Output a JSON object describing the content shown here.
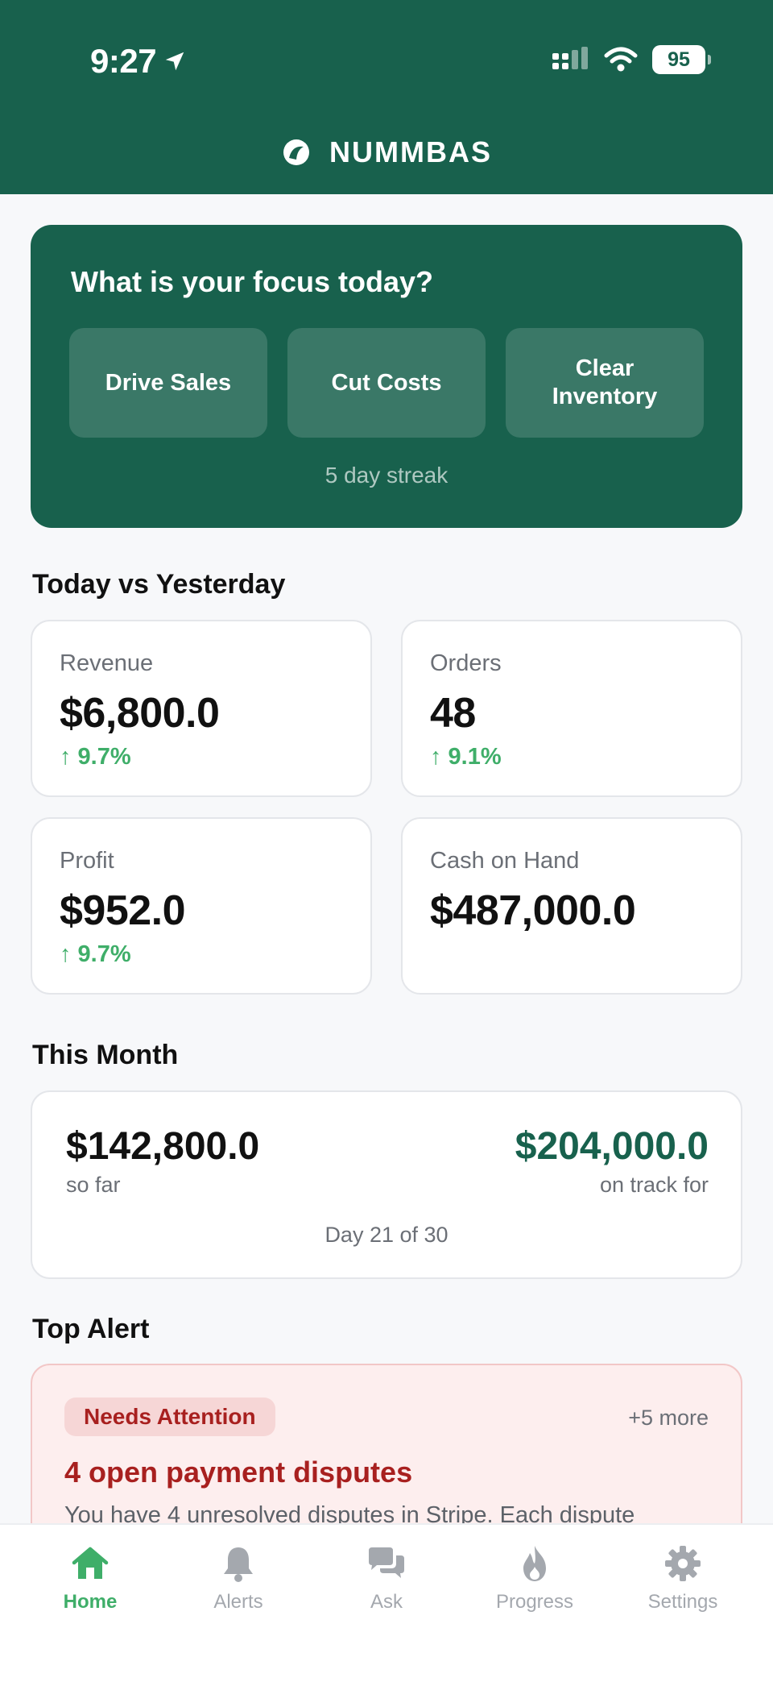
{
  "status_bar": {
    "time": "9:27",
    "battery": "95"
  },
  "app": {
    "brand": "NUMMBAS"
  },
  "focus": {
    "title": "What is your focus today?",
    "options": [
      "Drive Sales",
      "Cut Costs",
      "Clear Inventory"
    ],
    "streak": "5 day streak"
  },
  "today": {
    "title": "Today vs Yesterday",
    "metrics": [
      {
        "label": "Revenue",
        "value": "$6,800.0",
        "change": "↑ 9.7%"
      },
      {
        "label": "Orders",
        "value": "48",
        "change": "↑ 9.1%"
      },
      {
        "label": "Profit",
        "value": "$952.0",
        "change": "↑ 9.7%"
      },
      {
        "label": "Cash on Hand",
        "value": "$487,000.0",
        "change": ""
      }
    ]
  },
  "month": {
    "title": "This Month",
    "so_far_value": "$142,800.0",
    "so_far_label": "so far",
    "on_track_value": "$204,000.0",
    "on_track_label": "on track for",
    "day": "Day 21 of 30"
  },
  "alert": {
    "section_title": "Top Alert",
    "badge": "Needs Attention",
    "more": "+5 more",
    "title": "4 open payment disputes",
    "body": "You have 4 unresolved disputes in Stripe. Each dispute"
  },
  "tabs": [
    {
      "label": "Home",
      "icon": "home-icon",
      "active": true
    },
    {
      "label": "Alerts",
      "icon": "bell-icon",
      "active": false
    },
    {
      "label": "Ask",
      "icon": "chat-icon",
      "active": false
    },
    {
      "label": "Progress",
      "icon": "flame-icon",
      "active": false
    },
    {
      "label": "Settings",
      "icon": "gear-icon",
      "active": false
    }
  ],
  "colors": {
    "brand_green": "#18614d",
    "positive": "#3fae69",
    "alert_red": "#a8201f",
    "inactive_tab": "#a4a8ae"
  }
}
